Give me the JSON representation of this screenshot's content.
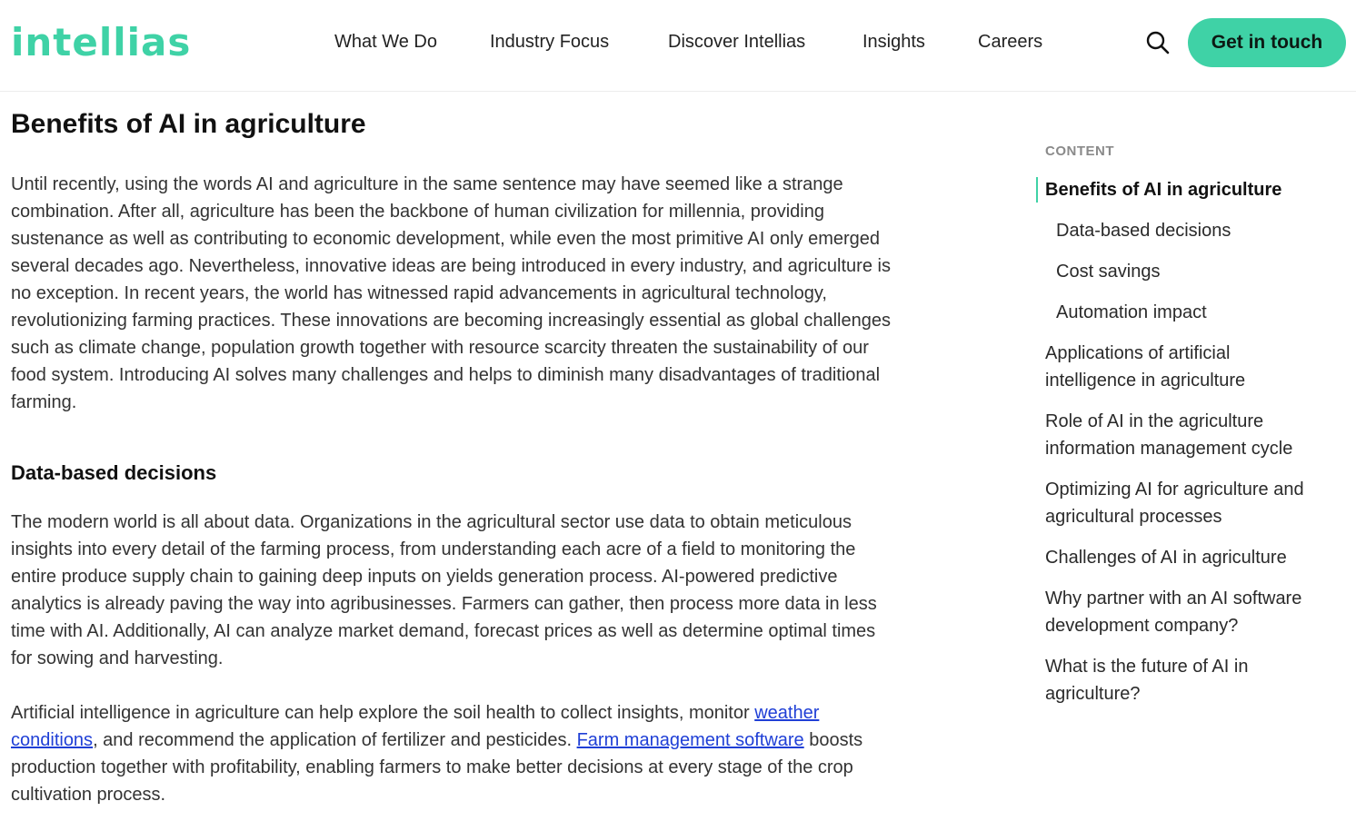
{
  "brand": {
    "logo_text": "intellias",
    "accent": "#3fd2a6"
  },
  "nav": {
    "items": [
      "What We Do",
      "Industry Focus",
      "Discover Intellias",
      "Insights",
      "Careers"
    ],
    "search_icon": "search-icon",
    "cta_label": "Get in touch"
  },
  "article": {
    "title": "Benefits of AI in agriculture",
    "intro": "Until recently, using the words AI and agriculture in the same sentence may have seemed like a strange combination. After all, agriculture has been the backbone of human civilization for millennia, providing sustenance as well as contributing to economic development, while even the most primitive AI only emerged several decades ago. Nevertheless, innovative ideas are being introduced in every industry, and agriculture is no exception. In recent years, the world has witnessed rapid advancements in agricultural technology, revolutionizing farming practices. These innovations are becoming increasingly essential as global challenges such as climate change, population growth together with resource scarcity threaten the sustainability of our food system. Introducing AI solves many challenges and helps to diminish many disadvantages of traditional farming.",
    "section_title": "Data-based decisions",
    "para2": "The modern world is all about data. Organizations in the agricultural sector use data to obtain meticulous insights into every detail of the farming process, from understanding each acre of a field to monitoring the entire produce supply chain to gaining deep inputs on yields generation process. AI-powered predictive analytics is already paving the way into agribusinesses. Farmers can gather, then process more data in less time with AI. Additionally, AI can analyze market demand, forecast prices as well as determine optimal times for sowing and harvesting.",
    "para3_a": "Artificial intelligence in agriculture can help explore the soil health to collect insights, monitor ",
    "para3_link1": "weather conditions",
    "para3_b": ", and recommend the application of fertilizer and pesticides. ",
    "para3_link2": "Farm management software",
    "para3_c": " boosts production together with profitability, enabling farmers to make better decisions at every stage of the crop cultivation process."
  },
  "toc": {
    "heading": "CONTENT",
    "items": [
      "Benefits of AI in agriculture",
      "Data-based decisions",
      "Cost savings",
      "Automation impact",
      "Applications of artificial intelligence in agriculture",
      "Role of AI in the agriculture information management cycle",
      "Optimizing AI for agriculture and agricultural processes",
      "Challenges of AI in agriculture",
      "Why partner with an AI software development company?",
      "What is the future of AI in agriculture?"
    ]
  }
}
